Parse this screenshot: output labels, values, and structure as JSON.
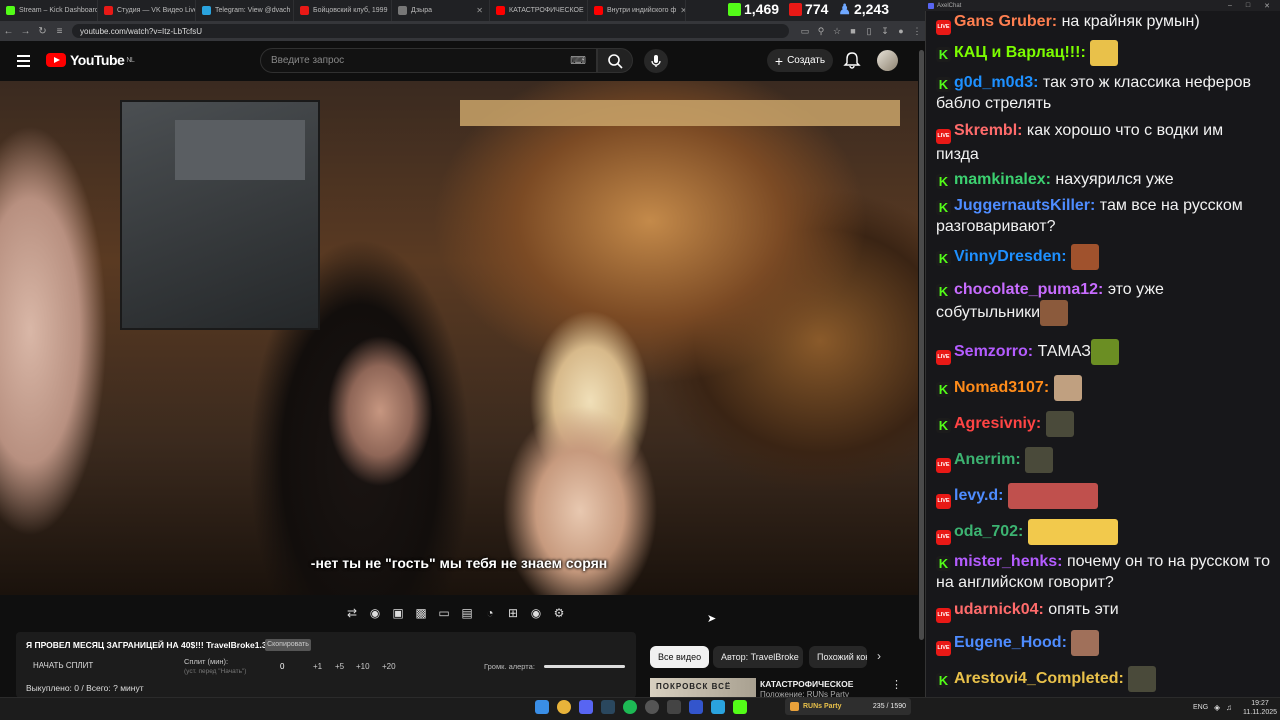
{
  "browser": {
    "tabs": [
      {
        "title": "Stream – Kick Dashboard",
        "color": "#53fc18"
      },
      {
        "title": "Студия — VK Видео Live",
        "color": "#e91916"
      },
      {
        "title": "Telegram: View @dvach",
        "color": "#2aa3de"
      },
      {
        "title": "Бойцовский клуб, 1999",
        "color": "#e91916"
      },
      {
        "title": "Дзыра",
        "color": "#777777"
      },
      {
        "title": "КАТАСТРОФИЧЕСКОЕ",
        "color": "#ff0000"
      },
      {
        "title": "Внутри индийского ф",
        "color": "#ff0000"
      }
    ],
    "url": "youtube.com/watch?v=Itz-LbTcfsU"
  },
  "stream_stats": {
    "kick": "1,469",
    "vk": "774",
    "total": "2,243"
  },
  "youtube": {
    "logo_text": "YouTube",
    "region": "NL",
    "search_placeholder": "Введите запрос",
    "create_label": "Создать",
    "subtitle": "-нет ты не \"гость\" мы тебя не знаем сорян",
    "split": {
      "title": "Я ПРОВЕЛ МЕСЯЦ ЗАГРАНИЦЕЙ НА 40$!!! TravelBroke1.3",
      "badge": "Скопировать",
      "start": "НАЧАТЬ СПЛИТ",
      "label": "Сплит (мин):",
      "hint": "(уст. перед \"Начать\")",
      "value": "0",
      "buttons": [
        "+1",
        "+5",
        "+10",
        "+20"
      ],
      "alert_label": "Громк. алерта:",
      "alert_volume": 1.0,
      "bought": "Выкуплено: 0 / Всего: ? минут"
    },
    "chips": [
      "Все видео",
      "Автор: TravelBroke",
      "Похожий кон"
    ],
    "recommendation": {
      "thumb_text": "ПОКРОВСК ВСЁ",
      "title": "КАТАСТРОФИЧЕСКОЕ",
      "subtitle": "Положение: RUNs Party"
    }
  },
  "chat": {
    "window_title": "AxelChat",
    "messages": [
      {
        "platform": "live",
        "user": "Gans Gruber:",
        "color": "#ff7f50",
        "text": " на крайняк румын)"
      },
      {
        "platform": "kick",
        "user": "КАЦ и Варлац!!!:",
        "color": "#7cfc00",
        "text": " ",
        "emote": "#e9c14a"
      },
      {
        "platform": "kick",
        "user": "g0d_m0d3:",
        "color": "#1e90ff",
        "text": " так это ж классика неферов бабло стрелять"
      },
      {
        "platform": "live",
        "user": "Skrembl:",
        "color": "#ff6b6b",
        "text": " как хорошо что с водки им пизда"
      },
      {
        "platform": "kick",
        "user": "mamkinalex:",
        "color": "#3cd070",
        "text": " нахуярился уже"
      },
      {
        "platform": "kick",
        "user": "JuggernautsKiller:",
        "color": "#4e8cff",
        "text": " там все на русском разговаривают?"
      },
      {
        "platform": "kick",
        "user": "VinnyDresden:",
        "color": "#1e90ff",
        "text": " ",
        "emote": "#a0522d"
      },
      {
        "platform": "kick",
        "user": "chocolate_puma12:",
        "color": "#c86cff",
        "text": " это уже собутыльники",
        "emote": "#8b5a3c"
      },
      {
        "platform": "live",
        "user": "Semzorro:",
        "color": "#b45cff",
        "text": " ТАМАЗ",
        "emote": "#6b8e23"
      },
      {
        "platform": "kick",
        "user": "Nomad3107:",
        "color": "#ff8c1a",
        "text": " ",
        "emote": "#c0a080"
      },
      {
        "platform": "kick",
        "user": "Agresivniy:",
        "color": "#ff4444",
        "text": " ",
        "emote": "#4a4a3a"
      },
      {
        "platform": "live",
        "user": "Anerrim:",
        "color": "#3cb371",
        "text": " ",
        "emote": "#4a4a3a"
      },
      {
        "platform": "live",
        "user": "levy.d:",
        "color": "#4e8cff",
        "text": " ",
        "emote": "#c0504d"
      },
      {
        "platform": "live",
        "user": "oda_702:",
        "color": "#3cb371",
        "text": " ",
        "emote": "#f2c94c"
      },
      {
        "platform": "kick",
        "user": "mister_henks:",
        "color": "#b45cff",
        "text": " почему он то на русском то на английском говорит?"
      },
      {
        "platform": "live",
        "user": "udarnick04:",
        "color": "#ff6b6b",
        "text": " опять эти"
      },
      {
        "platform": "live",
        "user": "Eugene_Hood:",
        "color": "#4e8cff",
        "text": " ",
        "emote": "#a0705a"
      },
      {
        "platform": "kick",
        "user": "Arestovi4_Completed:",
        "color": "#e9c14a",
        "text": " ",
        "emote": "#4a4a3a"
      }
    ]
  },
  "taskbar": {
    "widget_title": "RUNs Party",
    "widget_count": "235 / 1590",
    "lang": "ENG",
    "time": "19:27",
    "date": "11.11.2025"
  }
}
